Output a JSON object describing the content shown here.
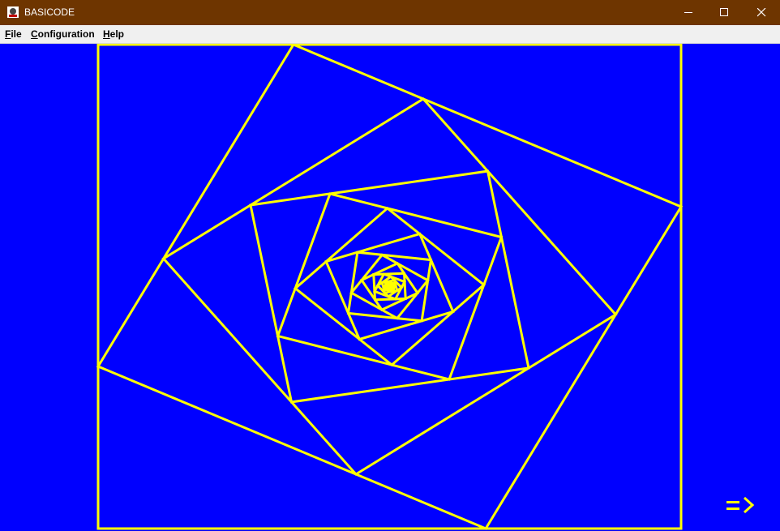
{
  "window": {
    "title": "BASICODE"
  },
  "menu": {
    "items": [
      {
        "label": "File"
      },
      {
        "label": "Configuration"
      },
      {
        "label": "Help"
      }
    ]
  },
  "canvas": {
    "background": "#0000ff",
    "line_color": "#ffff00"
  },
  "titlebar": {
    "background": "#6e3500"
  }
}
